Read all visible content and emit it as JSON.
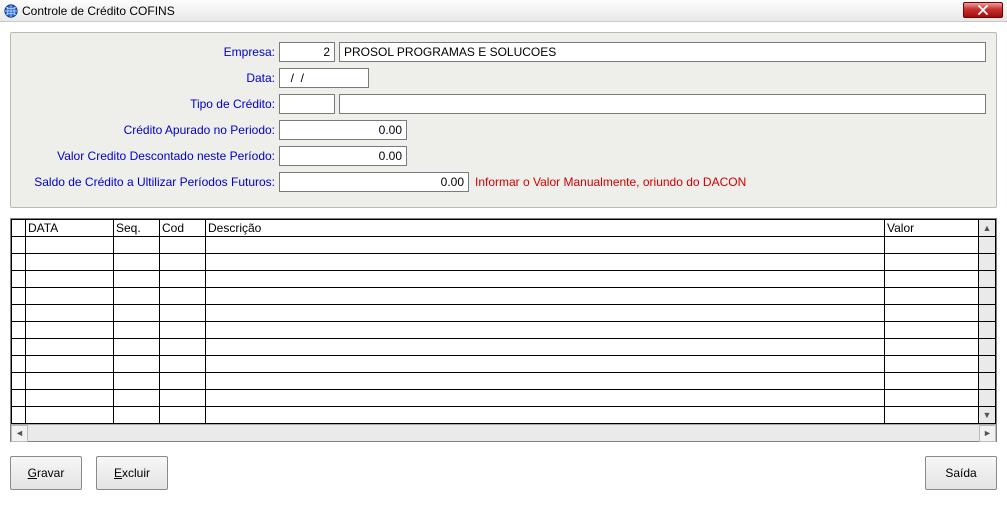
{
  "window": {
    "title": "Controle de Crédito COFINS"
  },
  "form": {
    "empresa_label": "Empresa:",
    "empresa_code": "2",
    "empresa_name": "PROSOL PROGRAMAS E SOLUCOES",
    "data_label": "Data:",
    "data_value": "  /  /",
    "tipo_label": "Tipo de Crédito:",
    "tipo_code": "",
    "tipo_desc": "",
    "credito_apurado_label": "Crédito Apurado no Periodo:",
    "credito_apurado_value": "0.00",
    "valor_descontado_label": "Valor Credito Descontado neste Período:",
    "valor_descontado_value": "0.00",
    "saldo_label": "Saldo de Crédito a Ultilizar Períodos Futuros:",
    "saldo_value": "0.00",
    "saldo_hint": "Informar o Valor Manualmente, oriundo do DACON"
  },
  "grid": {
    "columns": {
      "data": "DATA",
      "seq": "Seq.",
      "cod": "Cod",
      "desc": "Descrição",
      "valor": "Valor"
    },
    "row_count": 11
  },
  "buttons": {
    "gravar": "ravar",
    "gravar_accel": "G",
    "excluir": "xcluir",
    "excluir_accel": "E",
    "saida": "Saída"
  }
}
